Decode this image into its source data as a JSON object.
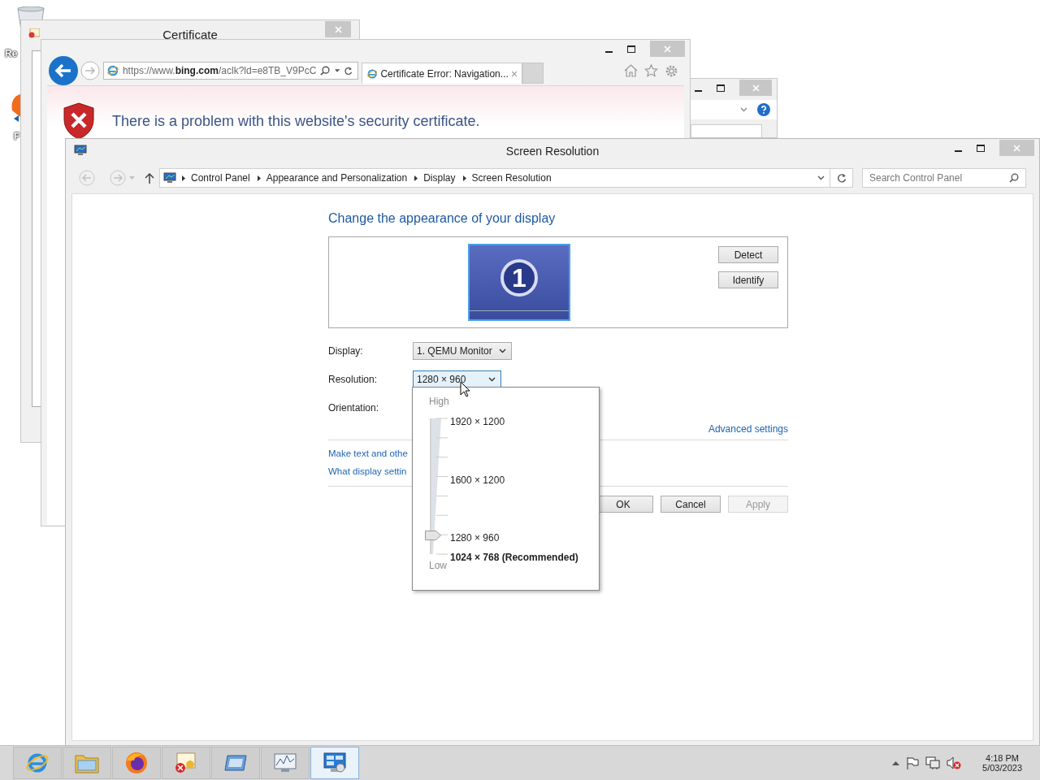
{
  "desktop_icons": [
    {
      "label": "Re"
    },
    {
      "label": "F"
    }
  ],
  "certificate_window": {
    "title": "Certificate"
  },
  "browser_window": {
    "address": "https://www.**bing.com**/aclk?ld=e8TB_V9PcC",
    "tab": "Certificate Error: Navigation...",
    "heading": "There is a problem with this website's security certificate."
  },
  "screen_resolution_window": {
    "title": "Screen Resolution",
    "breadcrumb": [
      "Control Panel",
      "Appearance and Personalization",
      "Display",
      "Screen Resolution"
    ],
    "search": {
      "placeholder": "Search Control Panel"
    },
    "heading": "Change the appearance of your display",
    "monitor_number": "1",
    "display_buttons": [
      "Detect",
      "Identify"
    ],
    "fields": [
      {
        "label": "Display:",
        "value": "1. QEMU Monitor",
        "open": false
      },
      {
        "label": "Resolution:",
        "value": "1280 × 960",
        "open": true
      },
      {
        "label": "Orientation:"
      }
    ],
    "advanced_link": "Advanced settings",
    "links": [
      "Make text and othe",
      "What display settin"
    ],
    "buttons": [
      {
        "label": "OK",
        "disabled": false
      },
      {
        "label": "Cancel",
        "disabled": false
      },
      {
        "label": "Apply",
        "disabled": true
      }
    ],
    "resolution_popup": {
      "high": "High",
      "low": "Low",
      "level": 0.14,
      "options": [
        {
          "label": "1920 × 1200",
          "recommended": false
        },
        {
          "label": "1600 × 1200",
          "recommended": false
        },
        {
          "label": "1280 × 960",
          "recommended": false
        },
        {
          "label": "1024 × 768 (Recommended)",
          "recommended": true
        }
      ]
    }
  },
  "taskbar": {
    "apps": [
      {
        "selected": false
      },
      {
        "selected": false
      },
      {
        "selected": false
      },
      {
        "selected": false
      },
      {
        "selected": false
      },
      {
        "selected": false
      },
      {
        "selected": true
      }
    ],
    "clock": {
      "time": "4:18 PM",
      "date": "5/03/2023"
    }
  }
}
